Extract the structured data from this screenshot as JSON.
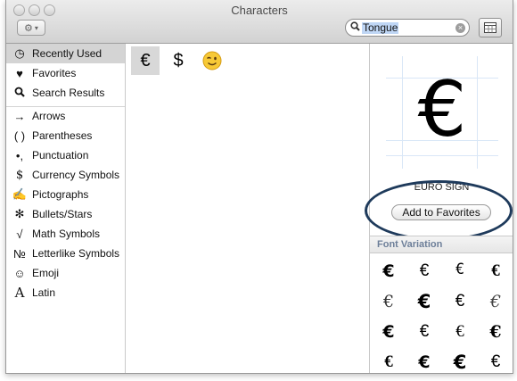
{
  "window": {
    "title": "Characters"
  },
  "toolbar": {
    "search_value": "Tongue",
    "clear_glyph": "×",
    "gear_glyph": "⚙",
    "gear_arrow": "▾"
  },
  "sidebar": {
    "items": [
      {
        "label": "Recently Used",
        "icon": "◷",
        "icon_name": "clock-icon",
        "selected": true
      },
      {
        "label": "Favorites",
        "icon": "♥",
        "icon_name": "heart-icon"
      },
      {
        "label": "Search Results",
        "icon": "🔍",
        "icon_name": "search-icon"
      },
      {
        "label": "Arrows",
        "icon": "→",
        "icon_name": "arrow-icon"
      },
      {
        "label": "Parentheses",
        "icon": "( )",
        "icon_name": "parentheses-icon"
      },
      {
        "label": "Punctuation",
        "icon": "•,",
        "icon_name": "punctuation-icon"
      },
      {
        "label": "Currency Symbols",
        "icon": "$",
        "icon_name": "dollar-icon"
      },
      {
        "label": "Pictographs",
        "icon": "✍",
        "icon_name": "pictograph-icon"
      },
      {
        "label": "Bullets/Stars",
        "icon": "✻",
        "icon_name": "asterisk-icon"
      },
      {
        "label": "Math Symbols",
        "icon": "√",
        "icon_name": "square-root-icon"
      },
      {
        "label": "Letterlike Symbols",
        "icon": "№",
        "icon_name": "numero-icon"
      },
      {
        "label": "Emoji",
        "icon": "☺",
        "icon_name": "smiley-icon"
      },
      {
        "label": "Latin",
        "icon": "A",
        "icon_name": "letter-a-icon"
      }
    ]
  },
  "characters": [
    {
      "glyph": "€",
      "selected": true
    },
    {
      "glyph": "$"
    },
    {
      "glyph": "😉"
    }
  ],
  "detail": {
    "preview_glyph": "€",
    "char_name": "EURO SIGN",
    "add_favorites_label": "Add to Favorites",
    "font_variation_title": "Font Variation",
    "variations": [
      "€",
      "€",
      "€",
      "€",
      "€",
      "€",
      "€",
      "€",
      "€",
      "€",
      "€",
      "€",
      "€",
      "€",
      "€",
      "€"
    ]
  },
  "colors": {
    "highlight_ring": "#1e3a5b",
    "search_selection": "#bfd6f5"
  }
}
